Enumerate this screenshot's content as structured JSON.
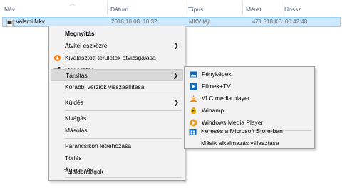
{
  "columns": {
    "name": "Név",
    "date": "Dátum",
    "type": "Típus",
    "size": "Méret",
    "length": "Hossz"
  },
  "file": {
    "name": "Valami.Mkv",
    "date": "2018.10.08. 10:32",
    "type": "MKV fájl",
    "size": "471 318 KB",
    "length": "00:42:48"
  },
  "context_menu": {
    "open": "Megnyitás",
    "cast": "Átvitel eszközre",
    "avast": "Kiválasztott területek átvizsgálása",
    "share": "Megosztás",
    "open_with": "Társítás",
    "restore": "Korábbi verziók visszaállítása",
    "send_to": "Küldés",
    "cut": "Kivágás",
    "copy": "Másolás",
    "shortcut": "Parancsikon létrehozása",
    "delete": "Törlés",
    "rename": "Átnevezés",
    "properties": "Tulajdonságok"
  },
  "open_with_menu": {
    "photos": "Fényképek",
    "films": "Filmek+TV",
    "vlc": "VLC media player",
    "winamp": "Winamp",
    "wmp": "Windows Media Player",
    "store": "Keresés a Microsoft Store-ban",
    "other": "Másik alkalmazás választása"
  },
  "colors": {
    "selection": "#cce8ff",
    "menu_bg": "#f2f2f2",
    "highlight": "#d9d9d9"
  }
}
